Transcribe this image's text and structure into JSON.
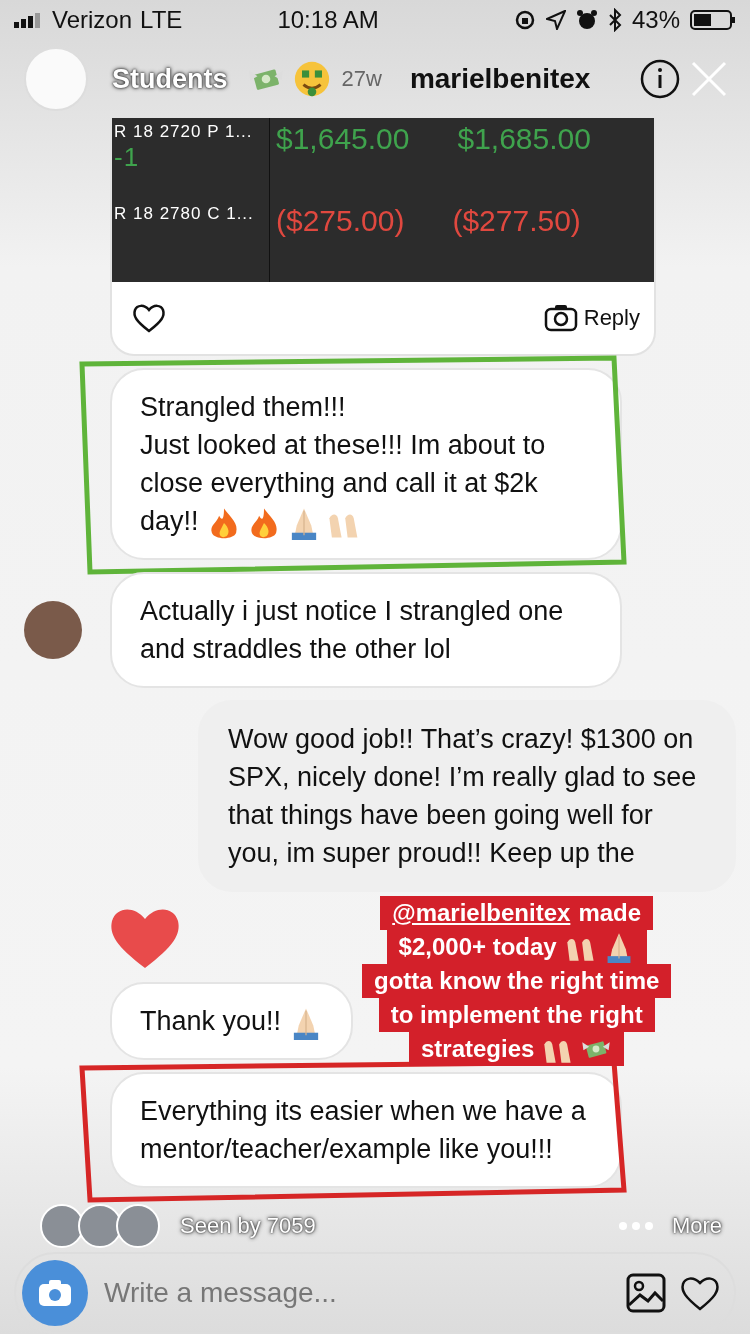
{
  "status_bar": {
    "carrier": "Verizon",
    "network": "LTE",
    "time": "10:18 AM",
    "battery": "43%"
  },
  "story_header": {
    "title": "Students",
    "emojis": [
      {
        "kind": "money-wings"
      },
      {
        "kind": "money-face"
      }
    ],
    "age": "27w"
  },
  "chat_header": {
    "username": "marielbenitex"
  },
  "messages": [
    {
      "kind": "media",
      "rows": [
        {
          "symbol": "R 18 2720 P 1...",
          "quantity": "-1",
          "kind": "gain",
          "values": [
            "$1,645.00",
            "$1,685.00"
          ]
        },
        {
          "symbol": "R 18 2780 C 1...",
          "kind": "loss",
          "values": [
            "($275.00)",
            "($277.50)"
          ]
        }
      ],
      "reply": "Reply"
    },
    {
      "kind": "received",
      "text": "Strangled them!!!\nJust looked at these!!! Im about to close everything and call it at $2k day!!",
      "emojis": [
        {
          "kind": "fire"
        },
        {
          "kind": "fire"
        },
        {
          "kind": "praying-hands"
        },
        {
          "kind": "raised-hands"
        }
      ],
      "color": "#5fb43a",
      "avatar": false
    },
    {
      "kind": "received",
      "text": "Actually i just notice I strangled one and straddles the other lol",
      "avatar": true
    },
    {
      "kind": "sent",
      "text": "Wow good job!! That’s crazy! $1300 on SPX, nicely done! I’m really glad to see that things have been going well for you, im super proud!! Keep up the"
    },
    {
      "kind": "like"
    },
    {
      "kind": "received",
      "text": "Thank you!!",
      "emojis": [
        {
          "kind": "praying-hands"
        }
      ],
      "avatar": false
    },
    {
      "kind": "received",
      "text": "Everything its easier when we have a mentor/teacher/example like you!!!",
      "color": "#d62626",
      "avatar": false
    }
  ],
  "sticker": {
    "lines": [
      {
        "mention": "@marielbenitex",
        "text": "made"
      },
      {
        "text": "$2,000+ today",
        "emojis": [
          {
            "kind": "raised-hands"
          },
          {
            "kind": "praying-hands"
          }
        ]
      },
      {
        "text": "gotta know the right time"
      },
      {
        "text": "to implement the right"
      },
      {
        "text": "strategies",
        "emojis": [
          {
            "kind": "raised-hands"
          },
          {
            "kind": "money-wings"
          }
        ]
      }
    ]
  },
  "footer": {
    "seen_by": "Seen by 7059",
    "more": "More"
  },
  "composer": {
    "placeholder": "Write a message..."
  }
}
